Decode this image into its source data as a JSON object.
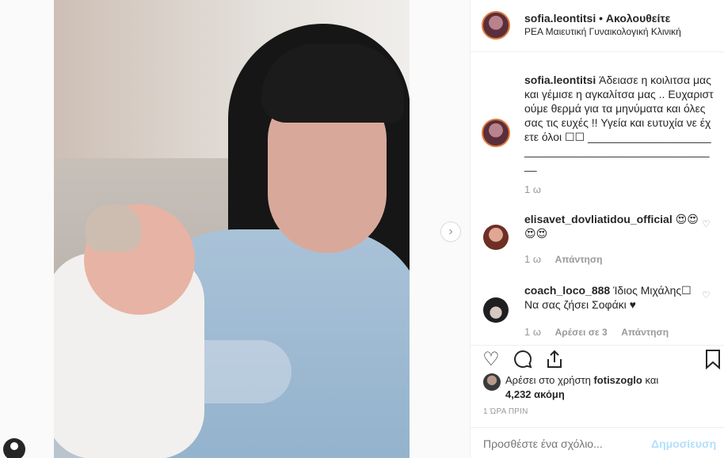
{
  "post": {
    "username": "sofia.leontitsi",
    "separator": "•",
    "follow_label": "Ακολουθείτε",
    "location": "ΡΕΑ Μαιευτική Γυναικολογική Κλινική"
  },
  "caption": {
    "username": "sofia.leontitsi",
    "text": "Άδειασε η κοιλιτσα μας και γέμισε η αγκαλίτσα μας .. Ευχαριστούμε θερμά για τα μηνύματα και όλες σας τις ευχές !! Υγεία και ευτυχία νε έχετε όλοι ☐☐ ____________________________________________________",
    "time": "1 ω"
  },
  "comments": [
    {
      "username": "elisavet_dovliatidou_official",
      "text": "😍😍 😍😍",
      "time": "1 ω",
      "reply_label": "Απάντηση"
    },
    {
      "username": "coach_loco_888",
      "text": "Ίδιος Μιχάλης☐ Να σας ζήσει Σοφάκι ♥",
      "time": "1 ω",
      "likes_label": "Αρέσει σε 3",
      "reply_label": "Απάντηση"
    }
  ],
  "likes": {
    "prefix": "Αρέσει στο χρήστη",
    "user": "fotiszoglo",
    "middle": "και",
    "count": "4,232 ακόμη"
  },
  "posted_ago": "1 ΏΡΑ ΠΡΙΝ",
  "comment_input": {
    "placeholder": "Προσθέστε ένα σχόλιο...",
    "post_label": "Δημοσίευση"
  },
  "icons": {
    "next": "chevron-right-icon",
    "like": "heart-icon",
    "comment": "speech-bubble-icon",
    "share": "share-icon",
    "save": "bookmark-icon"
  },
  "colors": {
    "link_blue_disabled": "#b2dffc",
    "muted": "#999999",
    "text": "#262626"
  }
}
